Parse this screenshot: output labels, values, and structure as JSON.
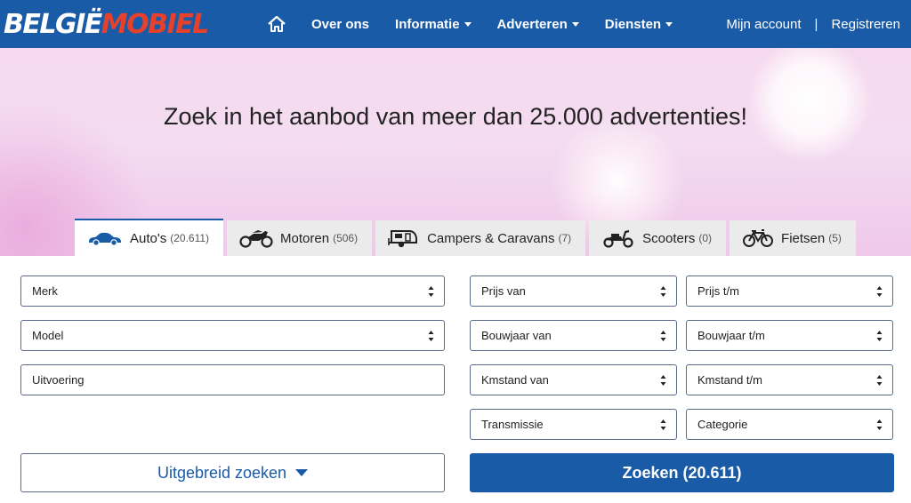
{
  "header": {
    "logo": {
      "part1": "BELGIË",
      "part2": "MOBIEL"
    },
    "nav": [
      {
        "label": "Over ons",
        "dropdown": false
      },
      {
        "label": "Informatie",
        "dropdown": true
      },
      {
        "label": "Adverteren",
        "dropdown": true
      },
      {
        "label": "Diensten",
        "dropdown": true
      }
    ],
    "account": {
      "login": "Mijn account",
      "separator": "|",
      "register": "Registreren"
    }
  },
  "hero": {
    "headline": "Zoek in het aanbod van meer dan 25.000 advertenties!"
  },
  "tabs": [
    {
      "label": "Auto's",
      "count": "(20.611)",
      "icon": "car-icon",
      "active": true
    },
    {
      "label": "Motoren",
      "count": "(506)",
      "icon": "motorcycle-icon",
      "active": false
    },
    {
      "label": "Campers & Caravans",
      "count": "(7)",
      "icon": "caravan-icon",
      "active": false
    },
    {
      "label": "Scooters",
      "count": "(0)",
      "icon": "scooter-icon",
      "active": false
    },
    {
      "label": "Fietsen",
      "count": "(5)",
      "icon": "bicycle-icon",
      "active": false
    }
  ],
  "form": {
    "merk": "Merk",
    "model": "Model",
    "uitvoering_placeholder": "Uitvoering",
    "prijs_van": "Prijs van",
    "prijs_tm": "Prijs t/m",
    "bouwjaar_van": "Bouwjaar van",
    "bouwjaar_tm": "Bouwjaar t/m",
    "kmstand_van": "Kmstand van",
    "kmstand_tm": "Kmstand t/m",
    "transmissie": "Transmissie",
    "categorie": "Categorie",
    "advanced_label": "Uitgebreid zoeken",
    "search_label": "Zoeken (20.611)"
  },
  "colors": {
    "brand_blue": "#1a5ba8",
    "logo_red": "#e8412b"
  }
}
